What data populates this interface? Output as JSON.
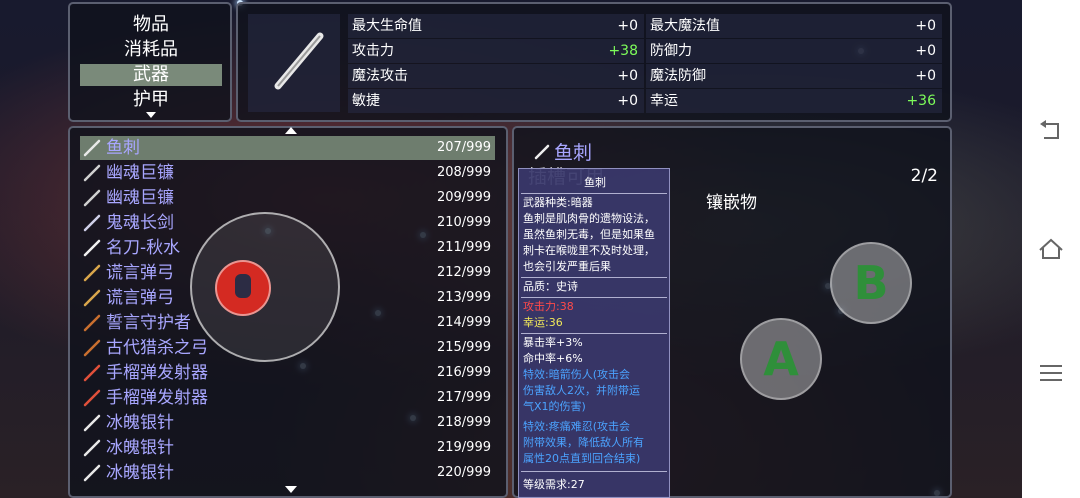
{
  "categories": {
    "items": [
      "物品",
      "消耗品",
      "武器",
      "护甲"
    ],
    "selected_index": 2,
    "more_icon": "triangle-down-icon"
  },
  "stats": {
    "left": [
      {
        "label": "最大生命值",
        "value": "+0"
      },
      {
        "label": "攻击力",
        "value": "+38"
      },
      {
        "label": "魔法攻击",
        "value": "+0"
      },
      {
        "label": "敏捷",
        "value": "+0"
      }
    ],
    "right": [
      {
        "label": "最大魔法值",
        "value": "+0"
      },
      {
        "label": "防御力",
        "value": "+0"
      },
      {
        "label": "魔法防御",
        "value": "+0"
      },
      {
        "label": "幸运",
        "value": "+36"
      }
    ],
    "positive_color": "#7dfc5a"
  },
  "items": [
    {
      "name": "鱼刺",
      "count": "207/999",
      "icon": "needle-icon"
    },
    {
      "name": "幽魂巨镰",
      "count": "208/999",
      "icon": "scythe-icon"
    },
    {
      "name": "幽魂巨镰",
      "count": "209/999",
      "icon": "scythe-icon"
    },
    {
      "name": "鬼魂长剑",
      "count": "210/999",
      "icon": "sword-icon"
    },
    {
      "name": "名刀-秋水",
      "count": "211/999",
      "icon": "katana-icon"
    },
    {
      "name": "谎言弹弓",
      "count": "212/999",
      "icon": "slingshot-icon"
    },
    {
      "name": "谎言弹弓",
      "count": "213/999",
      "icon": "slingshot-icon"
    },
    {
      "name": "誓言守护者",
      "count": "214/999",
      "icon": "bow-icon"
    },
    {
      "name": "古代猎杀之弓",
      "count": "215/999",
      "icon": "bow-icon"
    },
    {
      "name": "手榴弹发射器",
      "count": "216/999",
      "icon": "launcher-icon"
    },
    {
      "name": "手榴弹发射器",
      "count": "217/999",
      "icon": "launcher-icon"
    },
    {
      "name": "冰魄银针",
      "count": "218/999",
      "icon": "needle-icon"
    },
    {
      "name": "冰魄银针",
      "count": "219/999",
      "icon": "needle-icon"
    },
    {
      "name": "冰魄银针",
      "count": "220/999",
      "icon": "needle-icon"
    }
  ],
  "selected_item_index": 0,
  "detail": {
    "name": "鱼刺",
    "slot_label": "插槽可用",
    "slot_count": "2/2",
    "inlay_label": "镶嵌物"
  },
  "tooltip": {
    "title": "鱼刺",
    "type": "武器种类:暗器",
    "description": [
      "鱼刺是肌肉骨的遗物设法，",
      "虽然鱼刺无毒，但是如果鱼",
      "刺卡在喉咙里不及时处理，",
      "也会引发严重后果"
    ],
    "quality": "品质：史诗",
    "atk": "攻击力:38",
    "luck": "幸运:36",
    "crit": "暴击率+3%",
    "hit": "命中率+6%",
    "effect1": [
      "特效:暗箭伤人(攻击会",
      "伤害敌人2次，并附带运",
      "气X1的伤害)"
    ],
    "effect2": [
      "特效:疼痛难忍(攻击会",
      "附带效果，降低敌人所有",
      "属性20点直到回合结束)"
    ],
    "level_req": "等级需求:27",
    "effect_color": "#4ba3ff",
    "atk_color": "#ff4a4a",
    "luck_color": "#f0e85a"
  },
  "controls": {
    "a_label": "A",
    "b_label": "B",
    "button_color": "#2f8f3a"
  },
  "system_nav": {
    "back_icon": "back-icon",
    "home_icon": "home-icon",
    "menu_icon": "menu-icon"
  }
}
